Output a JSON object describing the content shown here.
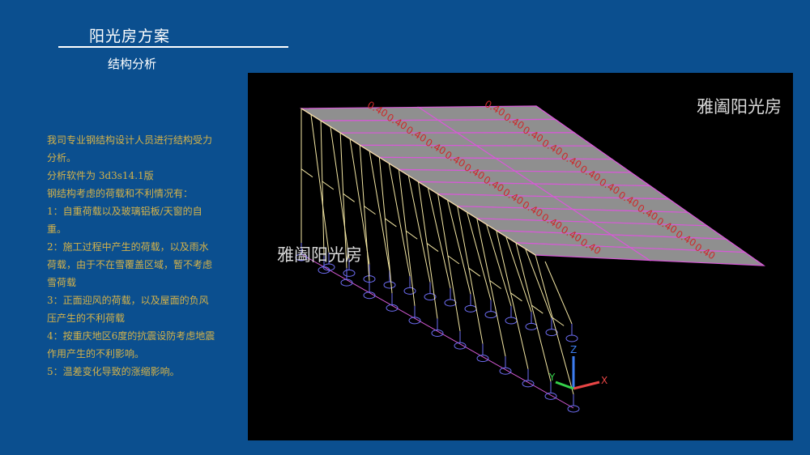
{
  "header": {
    "title": "阳光房方案",
    "subtitle": "结构分析"
  },
  "description": [
    "我司专业钢结构设计人员进行结构受力分析。",
    "分析软件为 3d3s14.1版",
    "钢结构考虑的荷载和不利情况有：",
    "1：自重荷载以及玻璃铝板/天窗的自重。",
    "2：施工过程中产生的荷载，以及雨水荷载，由于不在雪覆盖区域，暂不考虑雪荷载",
    "3：正面迎风的荷载，以及屋面的负风压产生的不利荷载",
    "4：按重庆地区6度的抗震设防考虑地震作用产生的不利影响。",
    "5：温差变化导致的涨缩影响。"
  ],
  "viewport": {
    "watermark_top": "雅阖阳光房",
    "watermark_left": "雅阖阳光房",
    "load_label": "0.40",
    "axis_labels": {
      "x": "X",
      "y": "Y",
      "z": "Z"
    },
    "colors": {
      "background": "#000000",
      "frame": "#f3e6a3",
      "roof_panel": "#8f8f8f",
      "panel_edge": "#d65ad6",
      "load_text": "#cc2b2b",
      "support": "#6e6ef5",
      "axis_x": "#e84545",
      "axis_y": "#35d04a",
      "axis_z": "#3d7df0"
    }
  }
}
